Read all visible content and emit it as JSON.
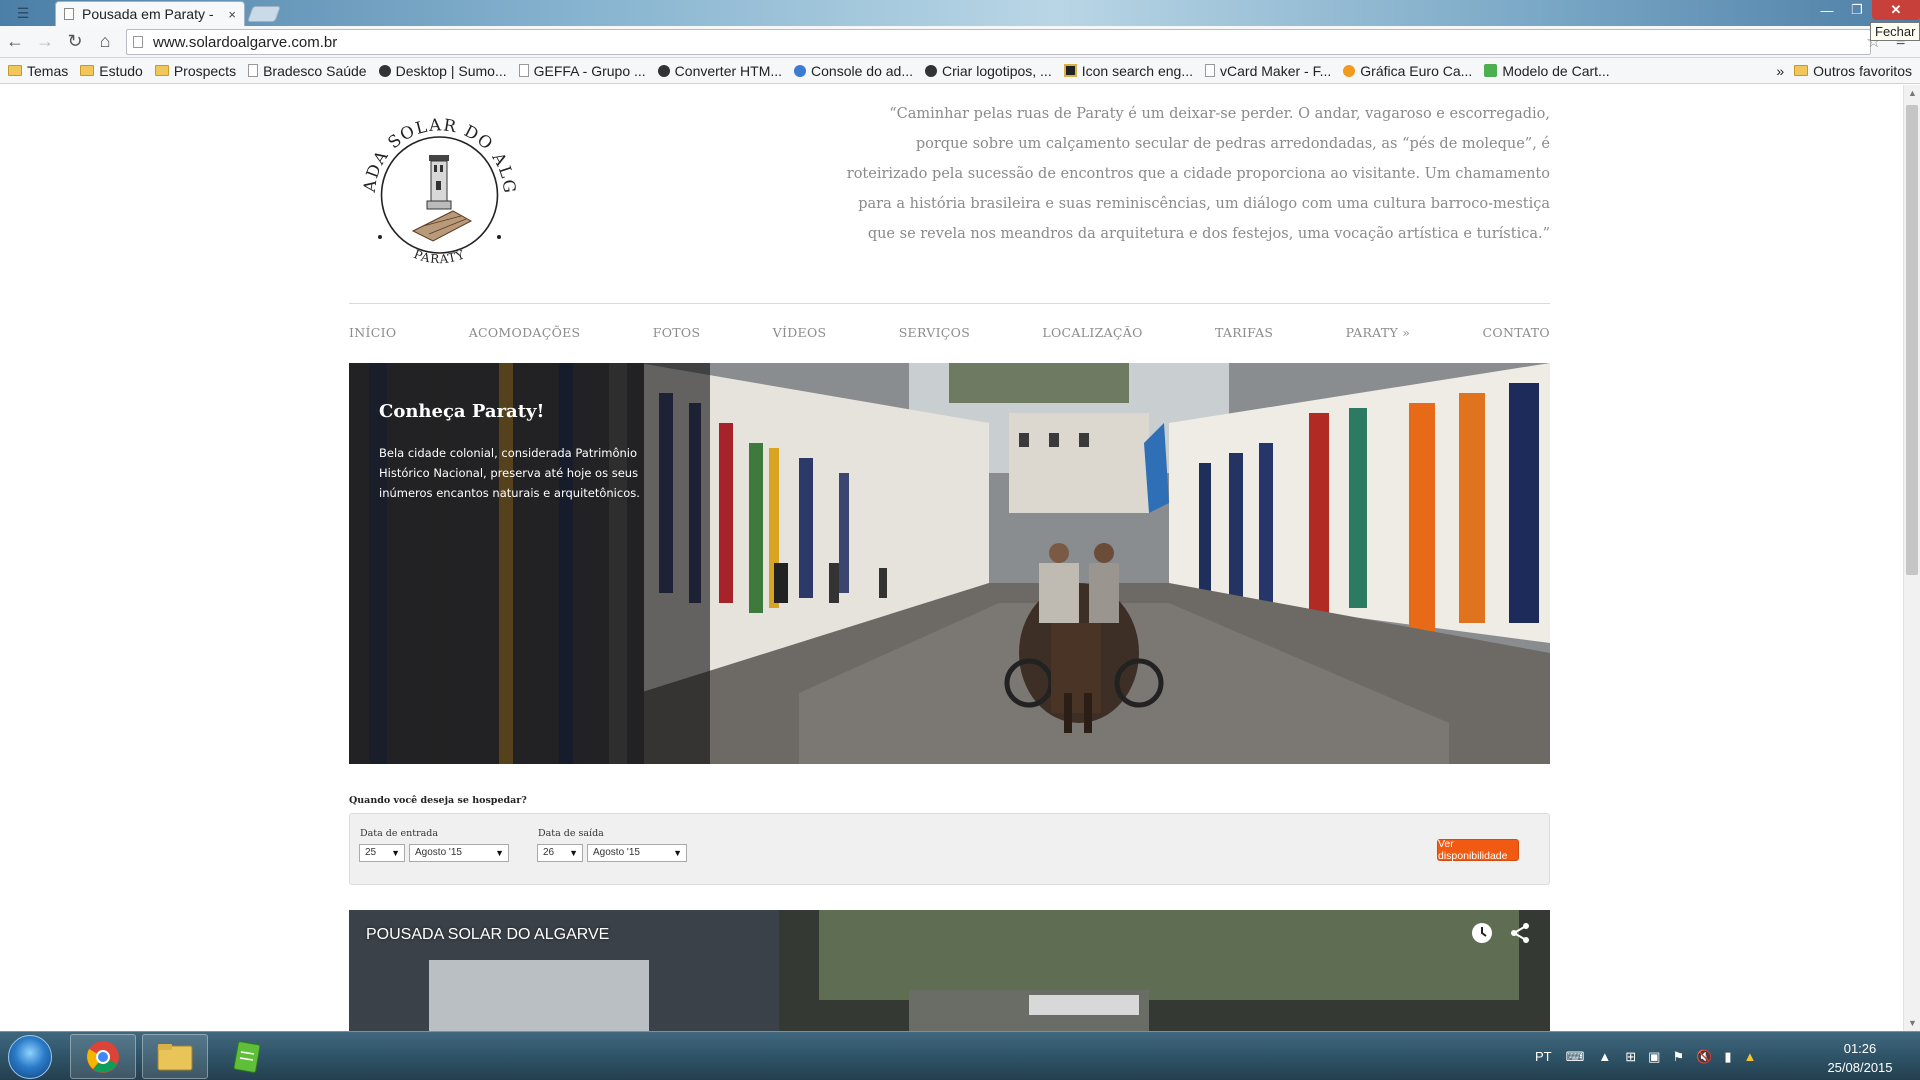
{
  "browser": {
    "tab_title": "Pousada em Paraty -",
    "tab_close": "×",
    "url": "www.solardoalgarve.com.br",
    "tooltip": "Fechar",
    "window_controls": [
      "—",
      "❐",
      "✕"
    ]
  },
  "bookmarks": {
    "items": [
      {
        "label": "Temas",
        "icon": "folder-icon"
      },
      {
        "label": "Estudo",
        "icon": "folder-icon"
      },
      {
        "label": "Prospects",
        "icon": "folder-icon"
      },
      {
        "label": "Bradesco Saúde",
        "icon": "page-icon"
      },
      {
        "label": "Desktop | Sumo...",
        "icon": "dark-icon"
      },
      {
        "label": "GEFFA - Grupo ...",
        "icon": "page-icon"
      },
      {
        "label": "Converter HTM...",
        "icon": "dark-icon"
      },
      {
        "label": "Console do ad...",
        "icon": "blue-icon"
      },
      {
        "label": "Criar logotipos, ...",
        "icon": "dark-icon"
      },
      {
        "label": "Icon search eng...",
        "icon": "gold-icon"
      },
      {
        "label": "vCard Maker - F...",
        "icon": "page-icon"
      },
      {
        "label": "Gráfica Euro Ca...",
        "icon": "orange-icon"
      },
      {
        "label": "Modelo de Cart...",
        "icon": "green-icon"
      }
    ],
    "more": "»",
    "other": "Outros favoritos"
  },
  "site": {
    "logo": {
      "top_text": "POUSADA SOLAR DO ALGARVE",
      "bottom_text": "PARATY"
    },
    "quote": "“Caminhar pelas ruas de Paraty é um deixar-se perder. O andar, vagaroso e escorregadio, porque sobre um calçamento secular de pedras arredondadas, as “pés de moleque”, é roteirizado pela sucessão de encontros que a cidade proporciona ao visitante. Um chamamento para a história brasileira e suas reminiscências, um diálogo com uma cultura barroco-mestiça que se revela nos meandros da arquitetura e dos festejos, uma vocação artística e turística.”",
    "nav": [
      "INÍCIO",
      "ACOMODAÇÕES",
      "FOTOS",
      "VÍDEOS",
      "SERVIÇOS",
      "LOCALIZAÇÃO",
      "TARIFAS",
      "PARATY »",
      "CONTATO"
    ],
    "hero": {
      "title": "Conheça Paraty!",
      "text": "Bela cidade colonial, considerada Patrimônio Histórico Nacional, preserva até hoje os seus inúmeros encantos naturais e arquitetônicos."
    },
    "booking": {
      "question": "Quando você deseja se hospedar?",
      "checkin_label": "Data de entrada",
      "checkin_day": "25",
      "checkin_month": "Agosto '15",
      "checkout_label": "Data de saída",
      "checkout_day": "26",
      "checkout_month": "Agosto '15",
      "button": "Ver disponibilidade"
    },
    "video": {
      "title": "POUSADA SOLAR DO ALGARVE"
    }
  },
  "taskbar": {
    "language": "PT",
    "time": "01:26",
    "date": "25/08/2015"
  },
  "colors": {
    "accent_button": "#f15a12",
    "nav_text": "#8c8c8c",
    "quote_text": "#8a8a8a"
  }
}
